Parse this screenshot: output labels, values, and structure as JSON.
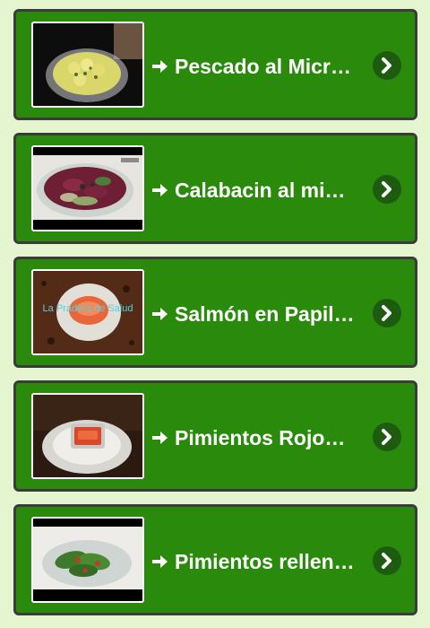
{
  "recipes": [
    {
      "title": "Pescado al Microondas",
      "thumb_icon": "fish-in-glass-bowl-photo"
    },
    {
      "title": "Calabacin al microondas",
      "thumb_icon": "zucchini-glass-bowl-photo"
    },
    {
      "title": "Salmón en Papillote",
      "thumb_icon": "salmon-plate-photo",
      "watermark": "La Pradera de Salud"
    },
    {
      "title": "Pimientos Rojos Asados",
      "thumb_icon": "red-peppers-plate-photo"
    },
    {
      "title": "Pimientos rellenos",
      "thumb_icon": "stuffed-peppers-bowl-photo"
    }
  ],
  "colors": {
    "page_background": "#e5f5d0",
    "card_background": "#2a8a0c",
    "card_border": "#3b3b3b",
    "chevron_background": "#1d5c10",
    "text": "#ffffff"
  },
  "icons": {
    "arrow": "arrow-right-icon",
    "chevron": "chevron-right-icon"
  }
}
